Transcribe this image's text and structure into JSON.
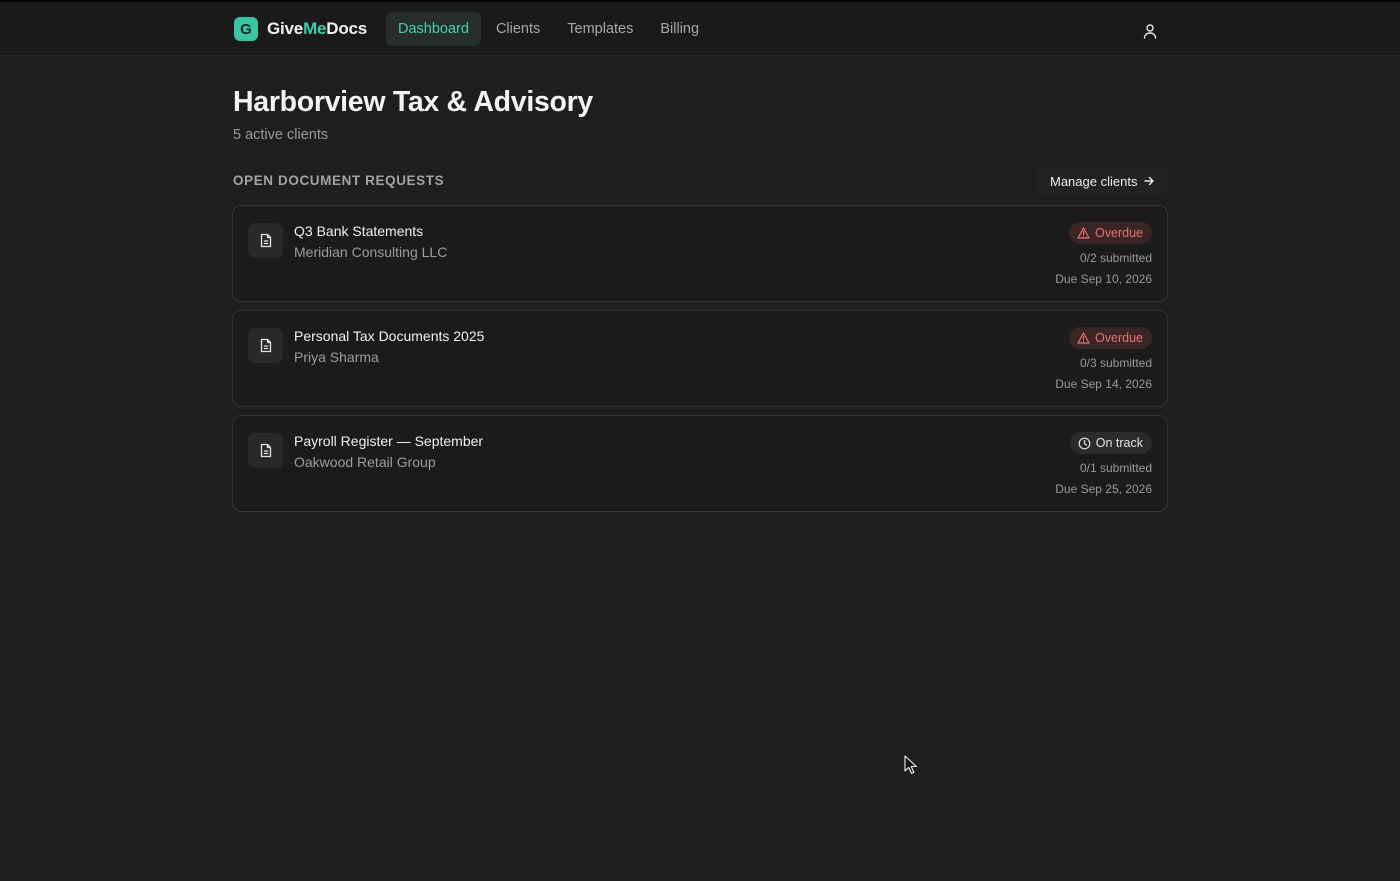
{
  "app": {
    "brand_part1": "Give",
    "brand_part2": "Me",
    "brand_part3": "Docs",
    "logo_letter": "G",
    "accent_color": "#3bc4a4"
  },
  "nav": {
    "items": [
      {
        "label": "Dashboard",
        "active": true
      },
      {
        "label": "Clients",
        "active": false
      },
      {
        "label": "Templates",
        "active": false
      },
      {
        "label": "Billing",
        "active": false
      }
    ],
    "user_icon": "user-icon"
  },
  "header": {
    "title": "Harborview Tax & Advisory",
    "subtitle": "5 active clients"
  },
  "section": {
    "label": "OPEN DOCUMENT REQUESTS",
    "manage_label": "Manage clients"
  },
  "requests": [
    {
      "title": "Q3 Bank Statements",
      "client": "Meridian Consulting LLC",
      "status": "Overdue",
      "status_icon": "warning-triangle-icon",
      "submitted": "0/2 submitted",
      "due": "Due Sep 10, 2026"
    },
    {
      "title": "Personal Tax Documents 2025",
      "client": "Priya Sharma",
      "status": "Overdue",
      "status_icon": "warning-triangle-icon",
      "submitted": "0/3 submitted",
      "due": "Due Sep 14, 2026"
    },
    {
      "title": "Payroll Register — September",
      "client": "Oakwood Retail Group",
      "status": "On track",
      "status_icon": "clock-icon",
      "submitted": "0/1 submitted",
      "due": "Due Sep 25, 2026"
    }
  ],
  "colors": {
    "overdue": "#ec7272",
    "on_track": "#e6e6e6",
    "nav_active": "#43d1ae"
  }
}
